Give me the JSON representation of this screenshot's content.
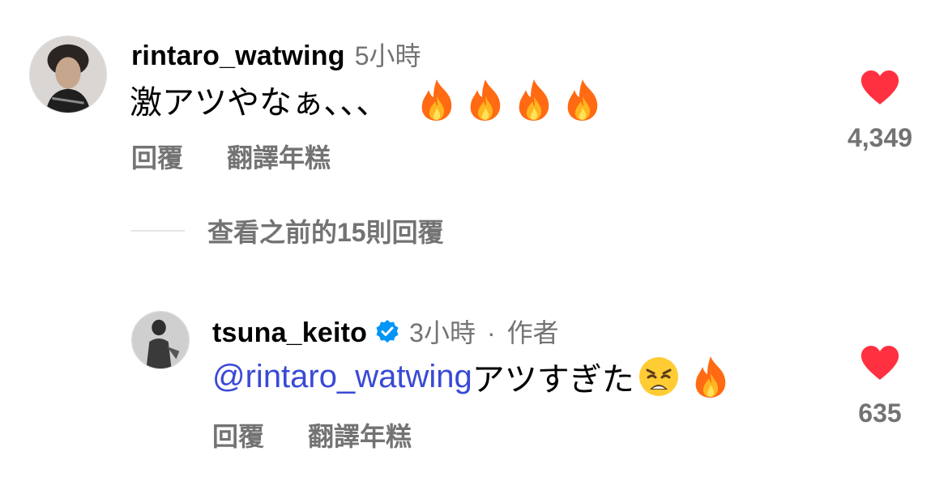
{
  "comments": [
    {
      "username": "rintaro_watwing",
      "time": "5小時",
      "text": "激アツやなぁ、、、",
      "emojis": [
        "fire",
        "fire",
        "fire",
        "fire"
      ],
      "reply_label": "回覆",
      "translate_label": "翻譯年糕",
      "likes": "4,349",
      "avatar_icon": "avatar-photo"
    }
  ],
  "view_replies_label": "查看之前的15則回覆",
  "reply": {
    "username": "tsuna_keito",
    "verified": true,
    "time": "3小時",
    "separator": "·",
    "author_label": "作者",
    "mention": "@rintaro_watwing",
    "text": " アツすぎた",
    "emojis": [
      "weary-face",
      "fire"
    ],
    "reply_label": "回覆",
    "translate_label": "翻譯年糕",
    "likes": "635"
  },
  "colors": {
    "heart": "#ff3040",
    "mention": "#3949d6",
    "verified": "#0095f6",
    "secondary_text": "#737373"
  }
}
